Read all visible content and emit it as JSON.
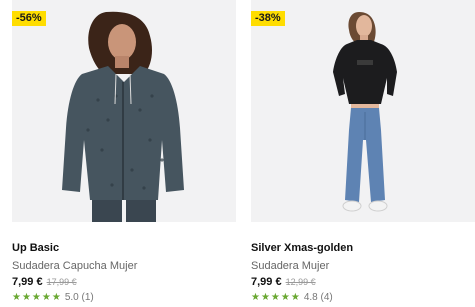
{
  "products": [
    {
      "discount": "-56%",
      "brand": "Up Basic",
      "subtitle": "Sudadera Capucha Mujer",
      "price": "7,99 €",
      "old_price": "17,99 €",
      "stars": "★★★★★",
      "rating": "5.0 (1)"
    },
    {
      "discount": "-38%",
      "brand": "Silver Xmas-golden",
      "subtitle": "Sudadera Mujer",
      "price": "7,99 €",
      "old_price": "12,99 €",
      "stars": "★★★★★",
      "rating": "4.8 (4)"
    }
  ],
  "colors": {
    "badge": "#ffdd00",
    "stars": "#6aa832",
    "image_bg": "#f2f2f3"
  }
}
